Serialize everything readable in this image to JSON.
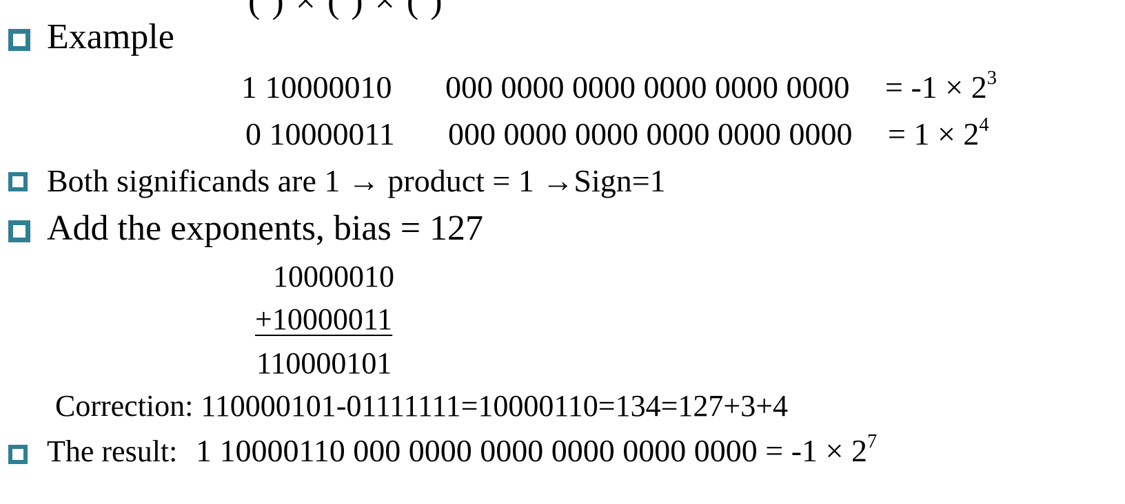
{
  "top_fragment": "(          )  ×  (          )  ×  (          )",
  "bullets": {
    "example": {
      "label": "Example"
    },
    "row1": {
      "sign_exp": "1 10000010",
      "mantissa": "000 0000 0000 0000 0000 0000",
      "value_prefix": "= -1 × 2",
      "power": "3"
    },
    "row2": {
      "sign_exp": "0 10000011",
      "mantissa": "000 0000 0000 0000 0000 0000",
      "value_prefix": "=  1 × 2",
      "power": "4"
    },
    "significands": {
      "text": "Both significands are 1 → product = 1 →Sign=1"
    },
    "exponents": {
      "text": "Add the exponents, bias = 127"
    },
    "sum": {
      "operand1": "10000010",
      "operand2": "+10000011",
      "result": "110000101"
    },
    "correction": {
      "text": "Correction: 110000101-01111111=10000110=134=127+3+4"
    },
    "result": {
      "label": "The result:",
      "value": "1 10000110 000 0000 0000 0000 0000 0000 = -1 × 2",
      "power": "7"
    }
  },
  "colors": {
    "bullet": "#2f7f95",
    "text": "#000000",
    "background": "#ffffff"
  }
}
